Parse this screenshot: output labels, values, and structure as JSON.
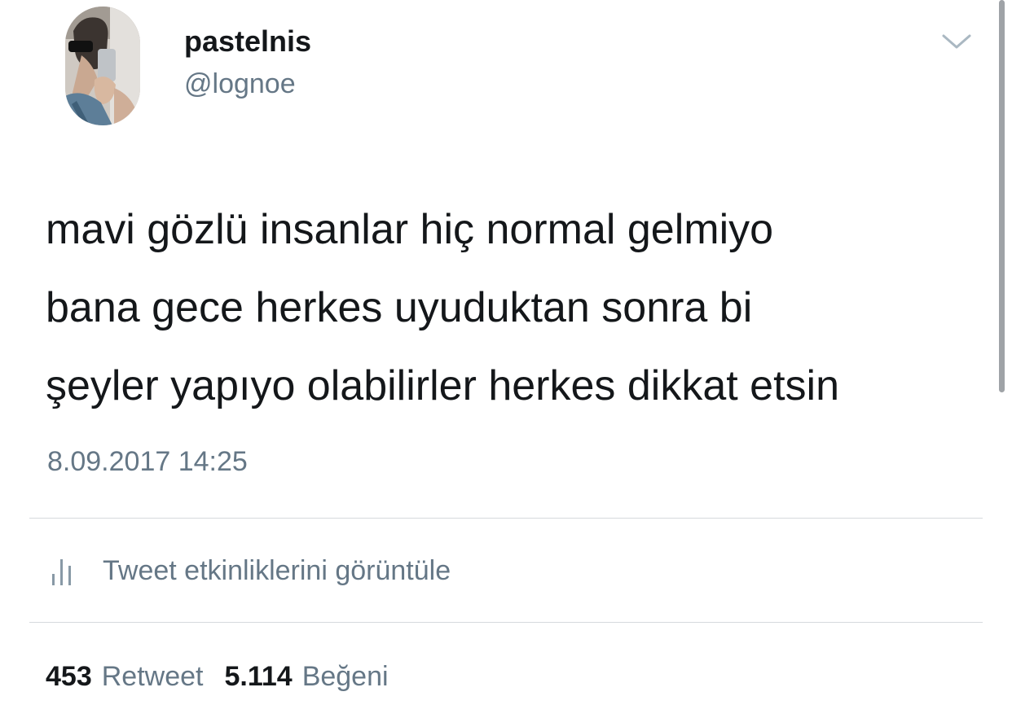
{
  "tweet": {
    "author": {
      "display_name": "pastelnis",
      "handle": "@lognoe"
    },
    "text_lines": [
      "mavi gözlü insanlar hiç normal gelmiyo",
      "bana gece herkes uyuduktan sonra bi",
      "şeyler yapıyo olabilirler herkes dikkat etsin"
    ],
    "timestamp": "8.09.2017 14:25",
    "activity_link": "Tweet etkinliklerini görüntüle",
    "stats": {
      "retweet_count": "453",
      "retweet_label": "Retweet",
      "like_count": "5.114",
      "like_label": "Beğeni"
    }
  },
  "icons": {
    "caret": "chevron-down-icon",
    "activity": "analytics-bars-icon"
  },
  "colors": {
    "primary_text": "#14171a",
    "secondary_text": "#657786",
    "divider": "#d6dadd",
    "background": "#ffffff"
  }
}
